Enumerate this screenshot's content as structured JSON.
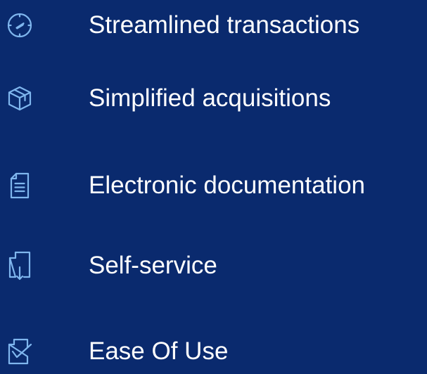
{
  "colors": {
    "background": "#0a2a6e",
    "icon": "#7fb6ee",
    "text": "#ffffff"
  },
  "features": [
    {
      "icon": "speedometer-icon",
      "label": "Streamlined transactions"
    },
    {
      "icon": "box-icon",
      "label": "Simplified acquisitions"
    },
    {
      "icon": "document-icon",
      "label": "Electronic documentation"
    },
    {
      "icon": "download-document-icon",
      "label": "Self-service"
    },
    {
      "icon": "checkmark-document-icon",
      "label": "Ease Of Use"
    }
  ]
}
